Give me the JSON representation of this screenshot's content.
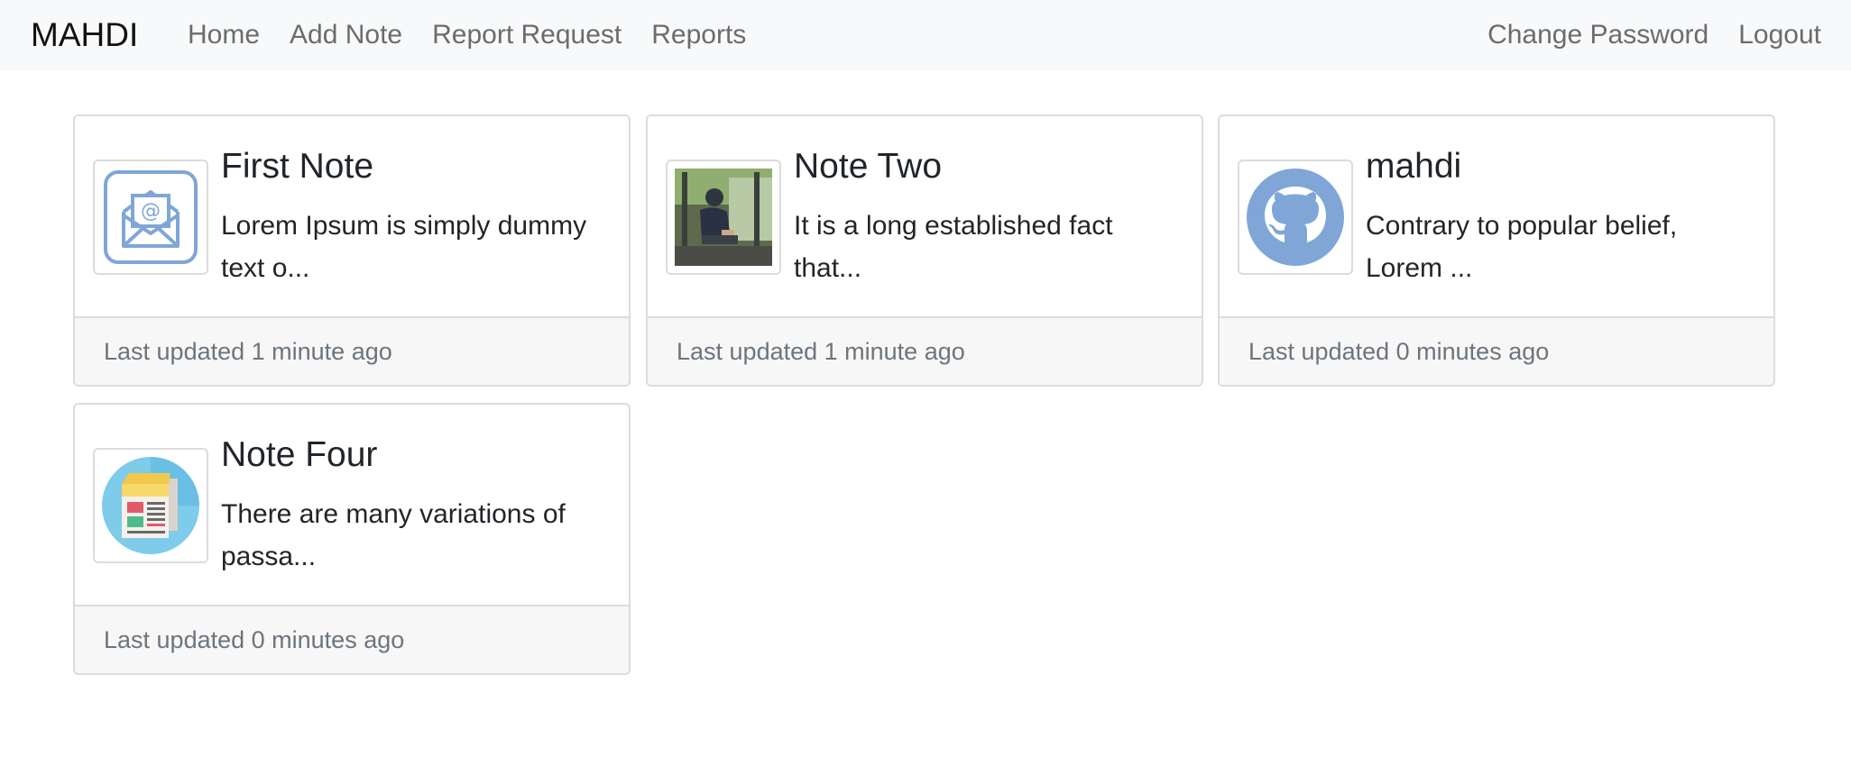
{
  "navbar": {
    "brand": "MAHDI",
    "links_left": [
      "Home",
      "Add Note",
      "Report Request",
      "Reports"
    ],
    "links_right": [
      "Change Password",
      "Logout"
    ]
  },
  "notes": [
    {
      "title": "First Note",
      "text": "Lorem Ipsum is simply dummy text o...",
      "footer": "Last updated 1 minute ago",
      "icon": "email-icon"
    },
    {
      "title": "Note Two",
      "text": "It is a long established fact that...",
      "footer": "Last updated 1 minute ago",
      "icon": "photo-thumbnail"
    },
    {
      "title": "mahdi",
      "text": "Contrary to popular belief, Lorem ...",
      "footer": "Last updated 0 minutes ago",
      "icon": "github-icon"
    },
    {
      "title": "Note Four",
      "text": "There are many variations of passa...",
      "footer": "Last updated 0 minutes ago",
      "icon": "newspaper-icon"
    }
  ],
  "colors": {
    "navbar_bg": "#f8f9fa",
    "card_border": "#dcdcdc",
    "footer_bg": "#f7f7f7",
    "footer_text": "#6c757d",
    "icon_blue": "#7fa6d6"
  }
}
